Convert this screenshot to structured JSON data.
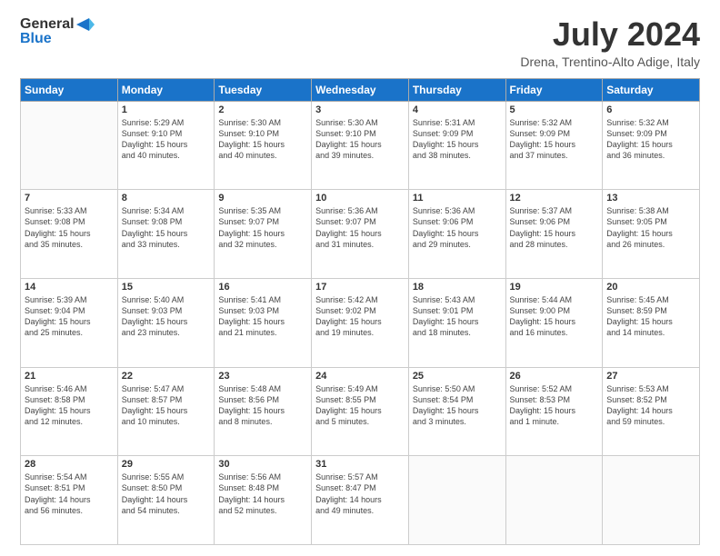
{
  "header": {
    "logo_general": "General",
    "logo_blue": "Blue",
    "month_year": "July 2024",
    "location": "Drena, Trentino-Alto Adige, Italy"
  },
  "weekdays": [
    "Sunday",
    "Monday",
    "Tuesday",
    "Wednesday",
    "Thursday",
    "Friday",
    "Saturday"
  ],
  "weeks": [
    [
      {
        "day": "",
        "info": ""
      },
      {
        "day": "1",
        "info": "Sunrise: 5:29 AM\nSunset: 9:10 PM\nDaylight: 15 hours\nand 40 minutes."
      },
      {
        "day": "2",
        "info": "Sunrise: 5:30 AM\nSunset: 9:10 PM\nDaylight: 15 hours\nand 40 minutes."
      },
      {
        "day": "3",
        "info": "Sunrise: 5:30 AM\nSunset: 9:10 PM\nDaylight: 15 hours\nand 39 minutes."
      },
      {
        "day": "4",
        "info": "Sunrise: 5:31 AM\nSunset: 9:09 PM\nDaylight: 15 hours\nand 38 minutes."
      },
      {
        "day": "5",
        "info": "Sunrise: 5:32 AM\nSunset: 9:09 PM\nDaylight: 15 hours\nand 37 minutes."
      },
      {
        "day": "6",
        "info": "Sunrise: 5:32 AM\nSunset: 9:09 PM\nDaylight: 15 hours\nand 36 minutes."
      }
    ],
    [
      {
        "day": "7",
        "info": "Sunrise: 5:33 AM\nSunset: 9:08 PM\nDaylight: 15 hours\nand 35 minutes."
      },
      {
        "day": "8",
        "info": "Sunrise: 5:34 AM\nSunset: 9:08 PM\nDaylight: 15 hours\nand 33 minutes."
      },
      {
        "day": "9",
        "info": "Sunrise: 5:35 AM\nSunset: 9:07 PM\nDaylight: 15 hours\nand 32 minutes."
      },
      {
        "day": "10",
        "info": "Sunrise: 5:36 AM\nSunset: 9:07 PM\nDaylight: 15 hours\nand 31 minutes."
      },
      {
        "day": "11",
        "info": "Sunrise: 5:36 AM\nSunset: 9:06 PM\nDaylight: 15 hours\nand 29 minutes."
      },
      {
        "day": "12",
        "info": "Sunrise: 5:37 AM\nSunset: 9:06 PM\nDaylight: 15 hours\nand 28 minutes."
      },
      {
        "day": "13",
        "info": "Sunrise: 5:38 AM\nSunset: 9:05 PM\nDaylight: 15 hours\nand 26 minutes."
      }
    ],
    [
      {
        "day": "14",
        "info": "Sunrise: 5:39 AM\nSunset: 9:04 PM\nDaylight: 15 hours\nand 25 minutes."
      },
      {
        "day": "15",
        "info": "Sunrise: 5:40 AM\nSunset: 9:03 PM\nDaylight: 15 hours\nand 23 minutes."
      },
      {
        "day": "16",
        "info": "Sunrise: 5:41 AM\nSunset: 9:03 PM\nDaylight: 15 hours\nand 21 minutes."
      },
      {
        "day": "17",
        "info": "Sunrise: 5:42 AM\nSunset: 9:02 PM\nDaylight: 15 hours\nand 19 minutes."
      },
      {
        "day": "18",
        "info": "Sunrise: 5:43 AM\nSunset: 9:01 PM\nDaylight: 15 hours\nand 18 minutes."
      },
      {
        "day": "19",
        "info": "Sunrise: 5:44 AM\nSunset: 9:00 PM\nDaylight: 15 hours\nand 16 minutes."
      },
      {
        "day": "20",
        "info": "Sunrise: 5:45 AM\nSunset: 8:59 PM\nDaylight: 15 hours\nand 14 minutes."
      }
    ],
    [
      {
        "day": "21",
        "info": "Sunrise: 5:46 AM\nSunset: 8:58 PM\nDaylight: 15 hours\nand 12 minutes."
      },
      {
        "day": "22",
        "info": "Sunrise: 5:47 AM\nSunset: 8:57 PM\nDaylight: 15 hours\nand 10 minutes."
      },
      {
        "day": "23",
        "info": "Sunrise: 5:48 AM\nSunset: 8:56 PM\nDaylight: 15 hours\nand 8 minutes."
      },
      {
        "day": "24",
        "info": "Sunrise: 5:49 AM\nSunset: 8:55 PM\nDaylight: 15 hours\nand 5 minutes."
      },
      {
        "day": "25",
        "info": "Sunrise: 5:50 AM\nSunset: 8:54 PM\nDaylight: 15 hours\nand 3 minutes."
      },
      {
        "day": "26",
        "info": "Sunrise: 5:52 AM\nSunset: 8:53 PM\nDaylight: 15 hours\nand 1 minute."
      },
      {
        "day": "27",
        "info": "Sunrise: 5:53 AM\nSunset: 8:52 PM\nDaylight: 14 hours\nand 59 minutes."
      }
    ],
    [
      {
        "day": "28",
        "info": "Sunrise: 5:54 AM\nSunset: 8:51 PM\nDaylight: 14 hours\nand 56 minutes."
      },
      {
        "day": "29",
        "info": "Sunrise: 5:55 AM\nSunset: 8:50 PM\nDaylight: 14 hours\nand 54 minutes."
      },
      {
        "day": "30",
        "info": "Sunrise: 5:56 AM\nSunset: 8:48 PM\nDaylight: 14 hours\nand 52 minutes."
      },
      {
        "day": "31",
        "info": "Sunrise: 5:57 AM\nSunset: 8:47 PM\nDaylight: 14 hours\nand 49 minutes."
      },
      {
        "day": "",
        "info": ""
      },
      {
        "day": "",
        "info": ""
      },
      {
        "day": "",
        "info": ""
      }
    ]
  ]
}
